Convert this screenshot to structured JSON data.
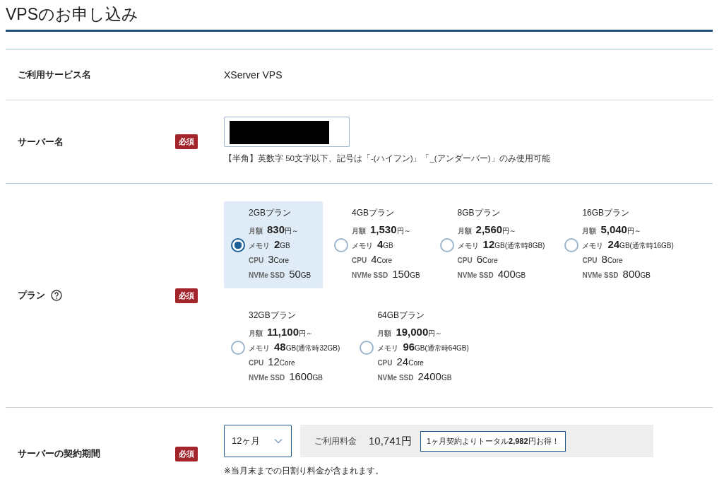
{
  "title": "VPSのお申し込み",
  "service": {
    "label": "ご利用サービス名",
    "value": "XServer VPS"
  },
  "server_name": {
    "label": "サーバー名",
    "badge": "必須",
    "redacted": true,
    "hint": "【半角】英数字 50文字以下、記号は「-(ハイフン)」「_(アンダーバー)」のみ使用可能"
  },
  "plan": {
    "label": "プラン",
    "help": true,
    "badge": "必須",
    "plans": [
      {
        "name": "2GBプラン",
        "selected": true,
        "specs": [
          {
            "label": "月額",
            "value": "830",
            "unit": "円～",
            "bold": true
          },
          {
            "label": "メモリ",
            "value": "2",
            "unit": "GB",
            "bold": true
          },
          {
            "label": "CPU",
            "value": "3",
            "unit": "Core",
            "bold": false
          },
          {
            "label": "NVMe SSD",
            "value": "50",
            "unit": "GB",
            "bold": false
          }
        ]
      },
      {
        "name": "4GBプラン",
        "selected": false,
        "specs": [
          {
            "label": "月額",
            "value": "1,530",
            "unit": "円～",
            "bold": true
          },
          {
            "label": "メモリ",
            "value": "4",
            "unit": "GB",
            "bold": true
          },
          {
            "label": "CPU",
            "value": "4",
            "unit": "Core",
            "bold": false
          },
          {
            "label": "NVMe SSD",
            "value": "150",
            "unit": "GB",
            "bold": false
          }
        ]
      },
      {
        "name": "8GBプラン",
        "selected": false,
        "specs": [
          {
            "label": "月額",
            "value": "2,560",
            "unit": "円～",
            "bold": true
          },
          {
            "label": "メモリ",
            "value": "12",
            "unit": "GB(通常時8GB)",
            "bold": true
          },
          {
            "label": "CPU",
            "value": "6",
            "unit": "Core",
            "bold": false
          },
          {
            "label": "NVMe SSD",
            "value": "400",
            "unit": "GB",
            "bold": false
          }
        ]
      },
      {
        "name": "16GBプラン",
        "selected": false,
        "specs": [
          {
            "label": "月額",
            "value": "5,040",
            "unit": "円～",
            "bold": true
          },
          {
            "label": "メモリ",
            "value": "24",
            "unit": "GB(通常時16GB)",
            "bold": true
          },
          {
            "label": "CPU",
            "value": "8",
            "unit": "Core",
            "bold": false
          },
          {
            "label": "NVMe SSD",
            "value": "800",
            "unit": "GB",
            "bold": false
          }
        ]
      },
      {
        "name": "32GBプラン",
        "selected": false,
        "specs": [
          {
            "label": "月額",
            "value": "11,100",
            "unit": "円～",
            "bold": true
          },
          {
            "label": "メモリ",
            "value": "48",
            "unit": "GB(通常時32GB)",
            "bold": true
          },
          {
            "label": "CPU",
            "value": "12",
            "unit": "Core",
            "bold": false
          },
          {
            "label": "NVMe SSD",
            "value": "1600",
            "unit": "GB",
            "bold": false
          }
        ]
      },
      {
        "name": "64GBプラン",
        "selected": false,
        "specs": [
          {
            "label": "月額",
            "value": "19,000",
            "unit": "円～",
            "bold": true
          },
          {
            "label": "メモリ",
            "value": "96",
            "unit": "GB(通常時64GB)",
            "bold": true
          },
          {
            "label": "CPU",
            "value": "24",
            "unit": "Core",
            "bold": false
          },
          {
            "label": "NVMe SSD",
            "value": "2400",
            "unit": "GB",
            "bold": false
          }
        ]
      }
    ]
  },
  "period": {
    "label": "サーバーの契約期間",
    "badge": "必須",
    "select": "12ヶ月",
    "fee_label": "ご利用料金",
    "fee": "10,741円",
    "saving": "1ヶ月契約よりトータル**2,982**円お得！",
    "note": "※当月末までの日割り料金が含まれます。"
  }
}
